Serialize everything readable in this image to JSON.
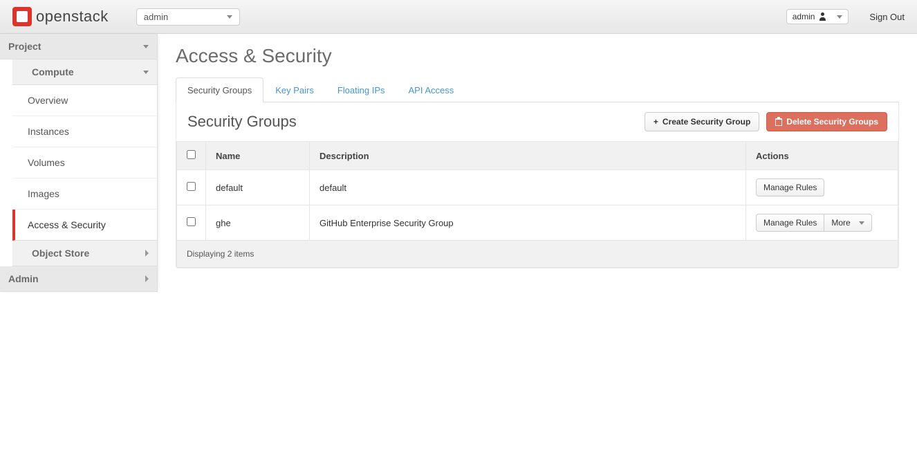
{
  "header": {
    "brand": "openstack",
    "tenant": "admin",
    "user": "admin",
    "signout": "Sign Out"
  },
  "sidebar": {
    "project_label": "Project",
    "compute_label": "Compute",
    "object_store_label": "Object Store",
    "admin_label": "Admin",
    "items": [
      {
        "label": "Overview"
      },
      {
        "label": "Instances"
      },
      {
        "label": "Volumes"
      },
      {
        "label": "Images"
      },
      {
        "label": "Access & Security"
      }
    ]
  },
  "main": {
    "title": "Access & Security",
    "tabs": [
      {
        "label": "Security Groups"
      },
      {
        "label": "Key Pairs"
      },
      {
        "label": "Floating IPs"
      },
      {
        "label": "API Access"
      }
    ],
    "panel_title": "Security Groups",
    "create_btn": "Create Security Group",
    "delete_btn": "Delete Security Groups",
    "columns": {
      "name": "Name",
      "description": "Description",
      "actions": "Actions"
    },
    "rows": [
      {
        "name": "default",
        "description": "default",
        "manage": "Manage Rules",
        "has_more": false
      },
      {
        "name": "ghe",
        "description": "GitHub Enterprise Security Group",
        "manage": "Manage Rules",
        "more": "More",
        "has_more": true
      }
    ],
    "footer": "Displaying 2 items"
  }
}
